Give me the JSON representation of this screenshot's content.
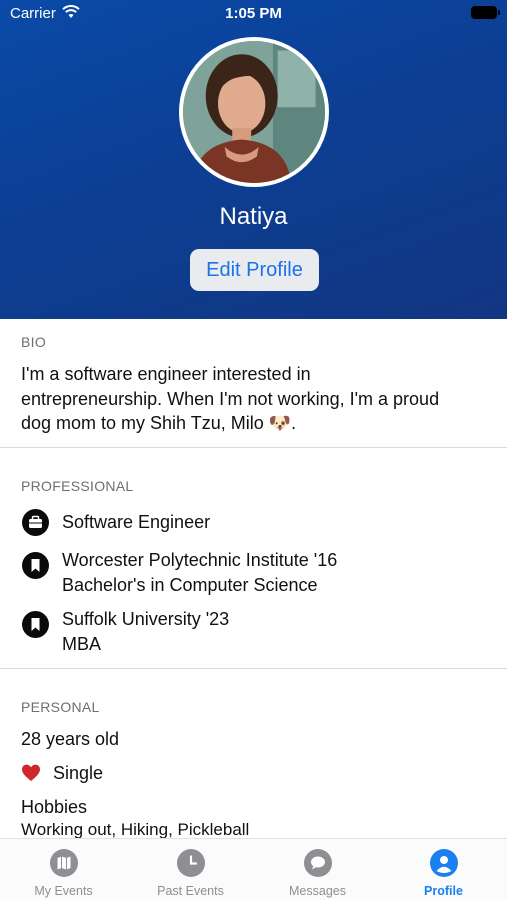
{
  "status_bar": {
    "carrier": "Carrier",
    "time": "1:05 PM"
  },
  "profile": {
    "name": "Natiya",
    "edit_button": "Edit Profile"
  },
  "bio": {
    "label": "BIO",
    "lines": [
      "I'm a software engineer interested in",
      "entrepreneurship. When I'm not working, I'm a proud",
      "dog mom to my Shih Tzu, Milo 🐶."
    ]
  },
  "professional": {
    "label": "PROFESSIONAL",
    "items": [
      {
        "icon": "briefcase-icon",
        "line1": "Software Engineer",
        "line2": ""
      },
      {
        "icon": "bookmark-icon",
        "line1": "Worcester Polytechnic Institute '16",
        "line2": "Bachelor's in Computer Science"
      },
      {
        "icon": "bookmark-icon",
        "line1": "Suffolk University '23",
        "line2": "MBA"
      }
    ]
  },
  "personal": {
    "label": "PERSONAL",
    "age": "28 years old",
    "relationship": "Single",
    "hobbies_label": "Hobbies",
    "hobbies": "Working out, Hiking, Pickleball"
  },
  "tabs": [
    {
      "label": "My Events",
      "icon": "map-icon",
      "active": false
    },
    {
      "label": "Past Events",
      "icon": "clock-icon",
      "active": false
    },
    {
      "label": "Messages",
      "icon": "chat-bubble-icon",
      "active": false
    },
    {
      "label": "Profile",
      "icon": "person-icon",
      "active": true
    }
  ],
  "colors": {
    "header": "#0c3f94",
    "accent": "#1a7ff0",
    "heart": "#d0262c"
  }
}
